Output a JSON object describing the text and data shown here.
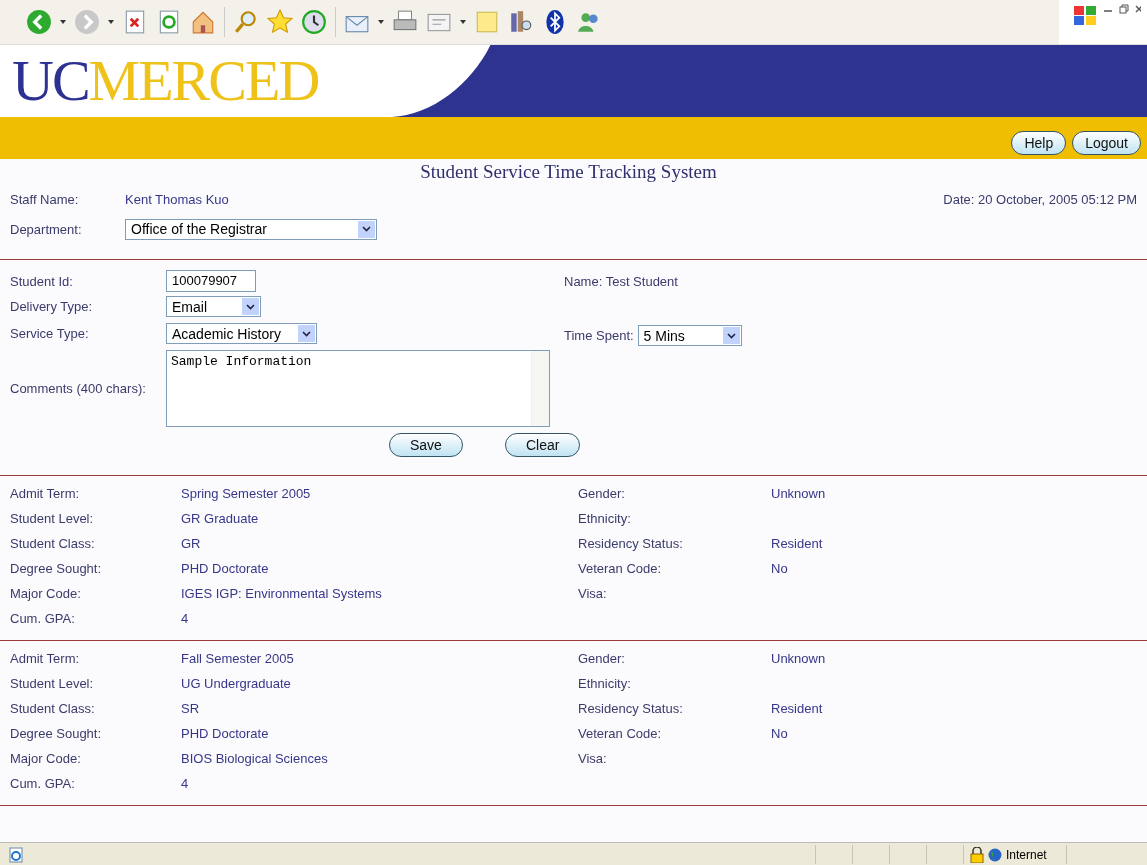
{
  "logo": {
    "part1": "UC",
    "part2": "MERCED"
  },
  "header_buttons": [
    "Help",
    "Logout"
  ],
  "title": "Student Service Time Tracking System",
  "staff": {
    "label": "Staff Name:",
    "value": "Kent Thomas Kuo",
    "date": "Date: 20 October, 2005 05:12 PM"
  },
  "department": {
    "label": "Department:",
    "value": "Office of the Registrar"
  },
  "form": {
    "student_id": {
      "label": "Student Id:",
      "value": "100079907"
    },
    "name": "Name: Test Student",
    "delivery": {
      "label": "Delivery Type:",
      "value": "Email"
    },
    "service": {
      "label": "Service Type:",
      "value": "Academic History"
    },
    "time": {
      "label": "Time Spent:",
      "value": "5 Mins"
    },
    "comments": {
      "label": "Comments (400 chars):",
      "value": "Sample Information"
    },
    "buttons": [
      "Save",
      "Clear"
    ]
  },
  "records": [
    {
      "rows": [
        {
          "label": "Admit Term:",
          "value": "Spring Semester 2005",
          "label2": "Gender:",
          "value2": "Unknown"
        },
        {
          "label": "Student Level:",
          "value": "GR  Graduate",
          "label2": "Ethnicity:"
        },
        {
          "label": "Student Class:",
          "value": "GR",
          "label2": "Residency Status:",
          "value2": "Resident"
        },
        {
          "label": "Degree Sought:",
          "value": "PHD  Doctorate",
          "label2": "Veteran Code:",
          "value2": "No"
        },
        {
          "label": "Major Code:",
          "value": "IGES  IGP: Environmental Systems",
          "label2": "Visa:"
        },
        {
          "label": "Cum. GPA:",
          "value": "4"
        }
      ]
    },
    {
      "rows": [
        {
          "label": "Admit Term:",
          "value": "Fall Semester 2005",
          "label2": "Gender:",
          "value2": "Unknown"
        },
        {
          "label": "Student Level:",
          "value": "UG  Undergraduate",
          "label2": "Ethnicity:"
        },
        {
          "label": "Student Class:",
          "value": "SR",
          "label2": "Residency Status:",
          "value2": "Resident"
        },
        {
          "label": "Degree Sought:",
          "value": "PHD  Doctorate",
          "label2": "Veteran Code:",
          "value2": "No"
        },
        {
          "label": "Major Code:",
          "value": "BIOS  Biological Sciences",
          "label2": "Visa:"
        },
        {
          "label": "Cum. GPA:",
          "value": "4"
        }
      ]
    }
  ],
  "status_bar": {
    "zone": "Internet"
  }
}
